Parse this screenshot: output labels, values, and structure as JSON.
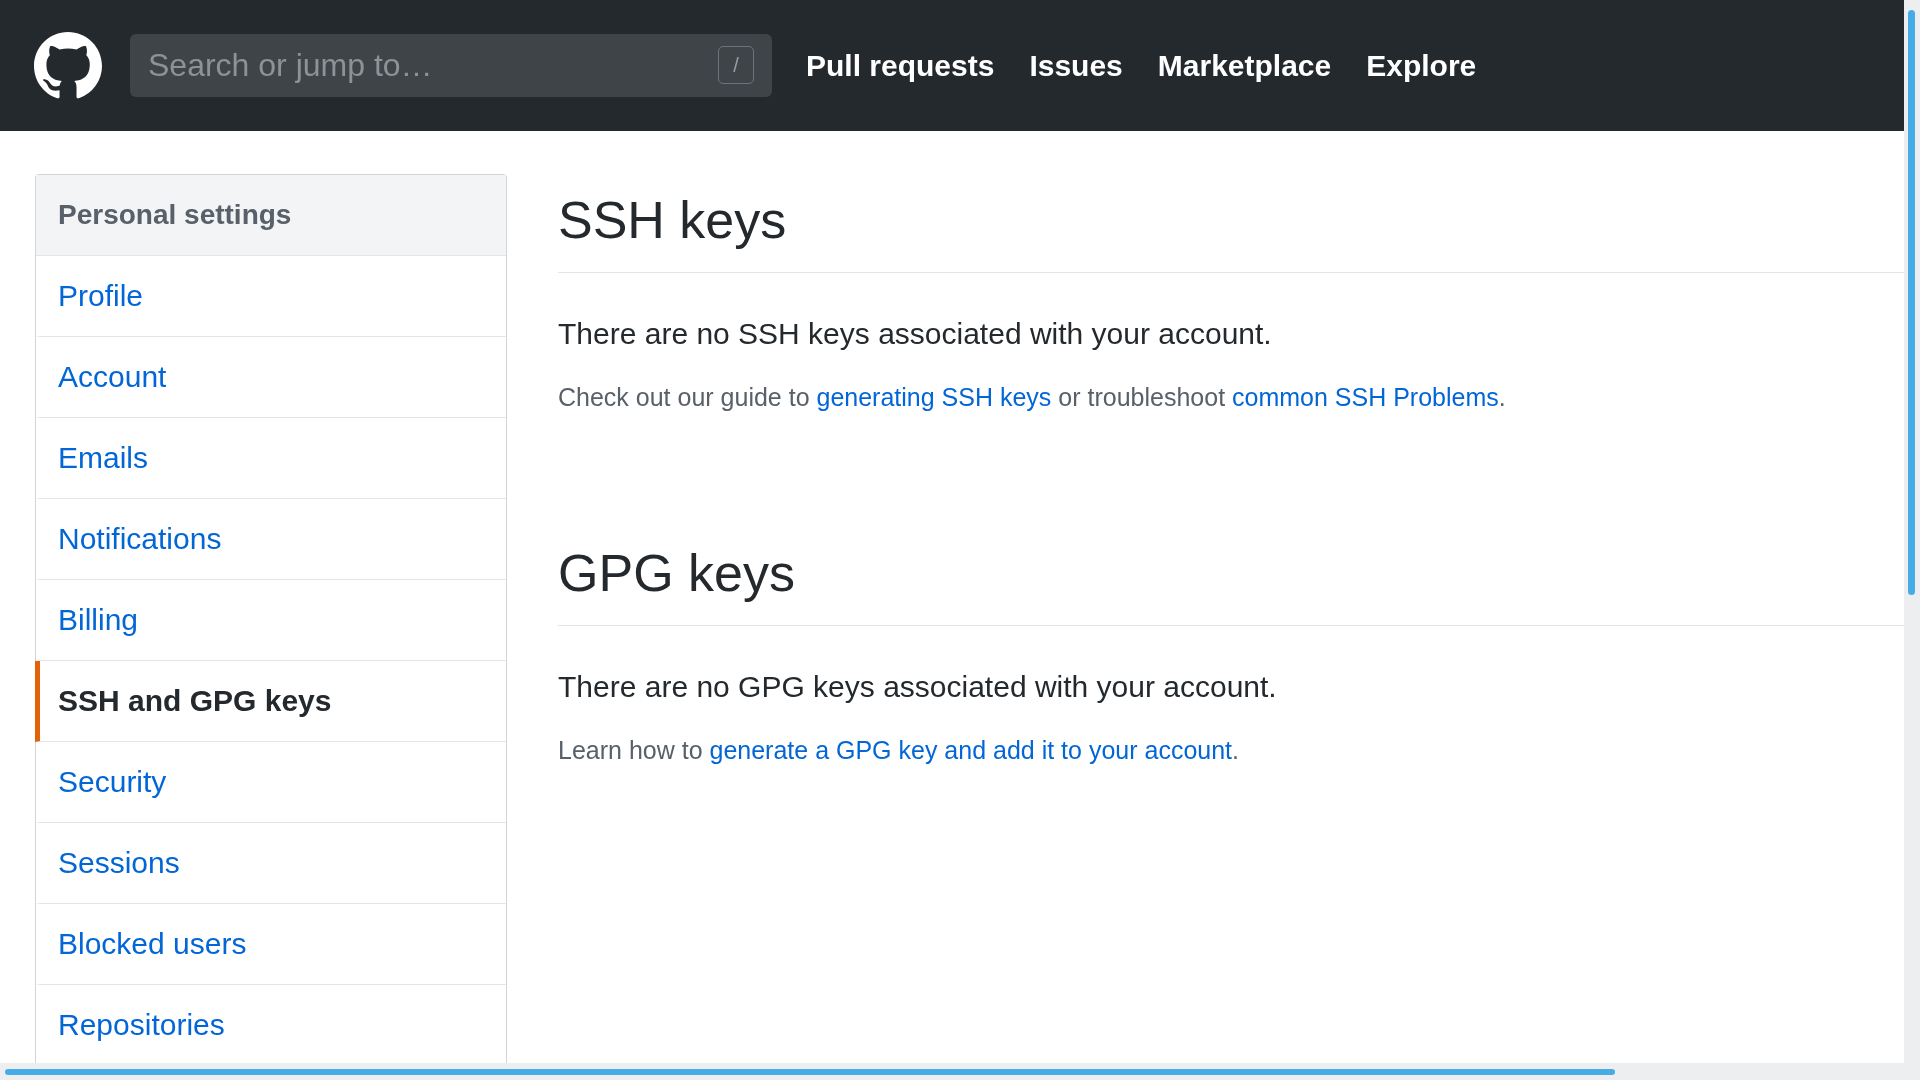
{
  "header": {
    "search": {
      "placeholder": "Search or jump to…",
      "shortcut": "/"
    },
    "nav": [
      "Pull requests",
      "Issues",
      "Marketplace",
      "Explore"
    ]
  },
  "sidebar": {
    "title": "Personal settings",
    "items": [
      {
        "label": "Profile",
        "selected": false
      },
      {
        "label": "Account",
        "selected": false
      },
      {
        "label": "Emails",
        "selected": false
      },
      {
        "label": "Notifications",
        "selected": false
      },
      {
        "label": "Billing",
        "selected": false
      },
      {
        "label": "SSH and GPG keys",
        "selected": true
      },
      {
        "label": "Security",
        "selected": false
      },
      {
        "label": "Sessions",
        "selected": false
      },
      {
        "label": "Blocked users",
        "selected": false
      },
      {
        "label": "Repositories",
        "selected": false
      }
    ]
  },
  "sections": [
    {
      "title": "SSH keys",
      "message": "There are no SSH keys associated with your account.",
      "note": [
        {
          "kind": "text",
          "text": "Check out our guide to "
        },
        {
          "kind": "link",
          "text": "generating SSH keys"
        },
        {
          "kind": "text",
          "text": " or troubleshoot "
        },
        {
          "kind": "link",
          "text": "common SSH Problems"
        },
        {
          "kind": "text",
          "text": "."
        }
      ]
    },
    {
      "title": "GPG keys",
      "message": "There are no GPG keys associated with your account.",
      "note": [
        {
          "kind": "text",
          "text": "Learn how to "
        },
        {
          "kind": "link",
          "text": "generate a GPG key and add it to your account"
        },
        {
          "kind": "text",
          "text": "."
        }
      ]
    }
  ]
}
